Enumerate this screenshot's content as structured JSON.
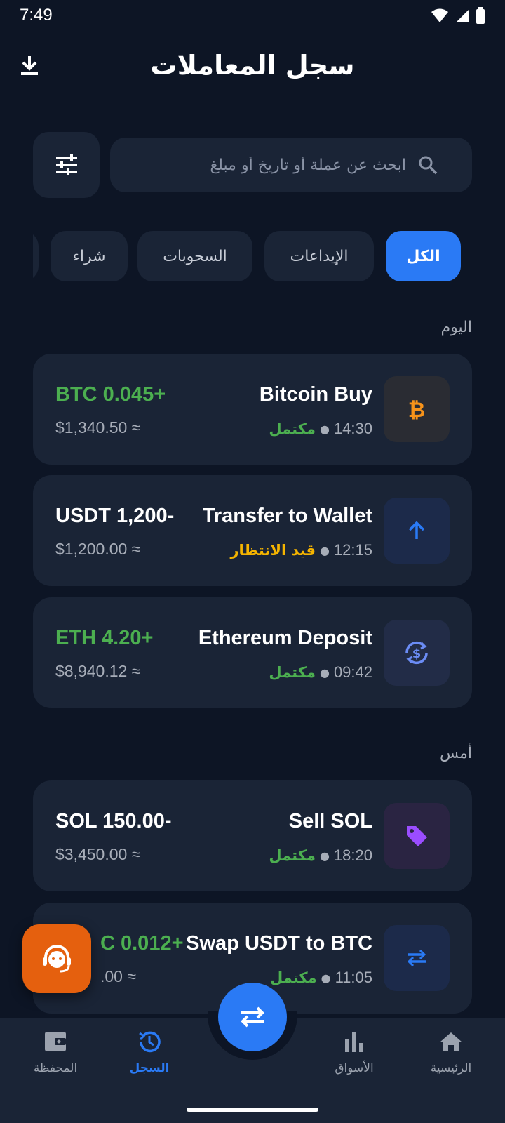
{
  "status_bar": {
    "time": "7:49"
  },
  "header": {
    "title": "سجل المعاملات"
  },
  "search": {
    "placeholder": "ابحث عن عملة أو تاريخ أو مبلغ"
  },
  "filters": [
    {
      "label": "الكل",
      "active": true
    },
    {
      "label": "الإيداعات",
      "active": false
    },
    {
      "label": "السحوبات",
      "active": false
    },
    {
      "label": "شراء",
      "active": false
    }
  ],
  "sections": [
    {
      "label": "اليوم"
    },
    {
      "label": "أمس"
    }
  ],
  "transactions": [
    {
      "title": "Bitcoin Buy",
      "time": "14:30",
      "status": "مكتمل",
      "status_color": "#4caf50",
      "amount": "BTC 0.045+",
      "amount_color": "#4caf50",
      "value": "$1,340.50 ≈",
      "icon": "bitcoin-icon"
    },
    {
      "title": "Transfer to Wallet",
      "time": "12:15",
      "status": "قيد الانتظار",
      "status_color": "#f5b400",
      "amount": "USDT 1,200-",
      "amount_color": "#ffffff",
      "value": "$1,200.00 ≈",
      "icon": "arrow-up-icon"
    },
    {
      "title": "Ethereum Deposit",
      "time": "09:42",
      "status": "مكتمل",
      "status_color": "#4caf50",
      "amount": "ETH 4.20+",
      "amount_color": "#4caf50",
      "value": "$8,940.12 ≈",
      "icon": "currency-exchange-icon"
    },
    {
      "title": "Sell SOL",
      "time": "18:20",
      "status": "مكتمل",
      "status_color": "#4caf50",
      "amount": "SOL 150.00-",
      "amount_color": "#ffffff",
      "value": "$3,450.00 ≈",
      "icon": "tag-icon"
    },
    {
      "title": "Swap USDT to BTC",
      "time": "11:05",
      "status": "مكتمل",
      "status_color": "#4caf50",
      "amount": "C 0.012+",
      "amount_color": "#4caf50",
      "value": ".00 ≈",
      "icon": "swap-icon"
    }
  ],
  "bottom_nav": [
    {
      "label": "المحفظة",
      "icon": "wallet-icon",
      "active": false
    },
    {
      "label": "السجل",
      "icon": "history-icon",
      "active": true
    },
    {
      "label": "الأسواق",
      "icon": "bar-chart-icon",
      "active": false
    },
    {
      "label": "الرئيسية",
      "icon": "home-icon",
      "active": false
    }
  ],
  "colors": {
    "background": "#0d1525",
    "surface": "#1a2436",
    "accent": "#2a7af5",
    "success": "#4caf50",
    "pending": "#f5b400",
    "support": "#e5600e"
  }
}
